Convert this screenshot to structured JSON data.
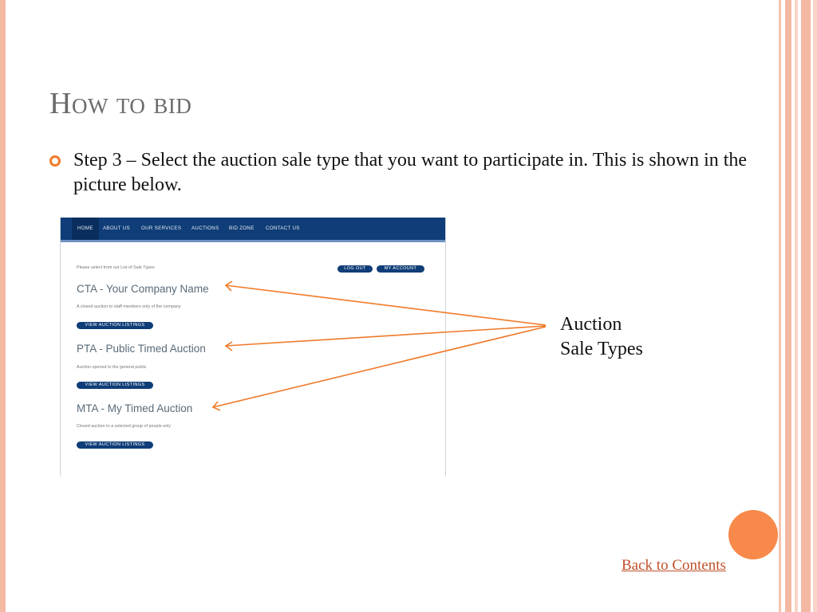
{
  "slide": {
    "title": "How to bid",
    "bullet_text": "Step 3 – Select the auction sale type that you want to participate in. This is shown in the picture below.",
    "annotation_line1": "Auction",
    "annotation_line2": "Sale Types",
    "back_link": "Back to Contents"
  },
  "screenshot": {
    "nav": [
      "HOME",
      "ABOUT US",
      "OUR SERVICES",
      "AUCTIONS",
      "BID ZONE",
      "CONTACT US"
    ],
    "intro": "Please select from our List of Sale Types",
    "logout_button": "LOG OUT",
    "account_button": "MY ACCOUNT",
    "sale_types": [
      {
        "title": "CTA - Your Company Name",
        "description": "A closed auction to staff members only of the company",
        "button": "VIEW AUCTION LISTINGS"
      },
      {
        "title": "PTA - Public Timed Auction",
        "description": "Auction opened to the general public",
        "button": "VIEW AUCTION LISTINGS"
      },
      {
        "title": "MTA - My Timed Auction",
        "description": "Closed auction to a selected group of people only",
        "button": "VIEW AUCTION LISTINGS"
      }
    ]
  },
  "colors": {
    "accent": "#f07a2a",
    "nav_blue": "#0f3d77",
    "title_gray": "#6b6b6b",
    "link": "#c0502a",
    "circle": "#f7894a"
  }
}
